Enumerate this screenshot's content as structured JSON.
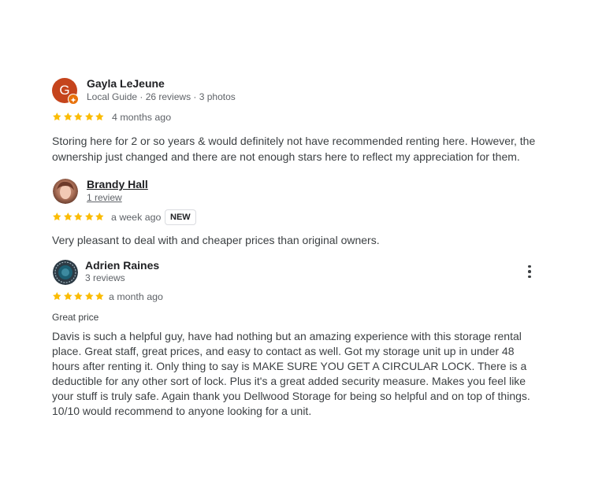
{
  "reviews": [
    {
      "name": "Gayla LeJeune",
      "meta": "Local Guide · 26 reviews · 3 photos",
      "avatar_letter": "G",
      "avatar_color": "#c5441c",
      "rating": 5,
      "time": "4 months ago",
      "text": "Storing here for 2 or so years & would definitely not have recommended renting here. However, the ownership just changed and there are not enough stars here to reflect my appreciation for them."
    },
    {
      "name": "Brandy Hall",
      "meta": "1 review",
      "rating": 5,
      "time": "a week ago",
      "badge": "NEW",
      "text": "Very pleasant to deal with and cheaper prices than original owners."
    },
    {
      "name": "Adrien Raines",
      "meta": "3 reviews",
      "rating": 5,
      "time": "a month ago",
      "subtitle": "Great price",
      "text": "Davis is such a helpful guy, have had nothing but an amazing experience with this storage rental place. Great staff, great prices, and easy to contact as well. Got my storage unit up in under 48 hours after renting it. Only thing to say is MAKE SURE YOU GET A CIRCULAR LOCK. There is a deductible for any other sort of lock. Plus it's a great added security measure. Makes you feel like your stuff is truly safe. Again thank you Dellwood Storage for being so helpful and on top of things. 10/10 would recommend to anyone looking for a unit."
    }
  ],
  "colors": {
    "star": "#fbbc04",
    "local_guide_badge": "#e8710a"
  },
  "icons": {
    "star": "star-icon",
    "more": "more-vert-icon",
    "local_guide": "local-guide-badge-icon"
  }
}
